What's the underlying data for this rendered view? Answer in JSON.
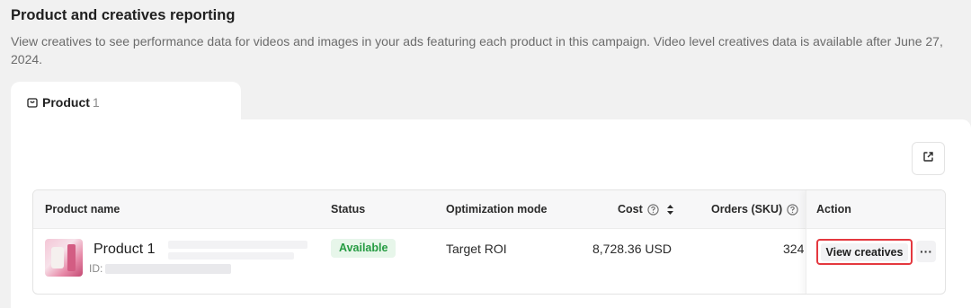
{
  "header": {
    "title": "Product and creatives reporting",
    "description": "View creatives to see performance data for videos and images in your ads featuring each product in this campaign. Video level creatives data is available after June 27, 2024."
  },
  "tabs": [
    {
      "label": "Product",
      "count": "1",
      "icon": "shopping-bag-icon"
    }
  ],
  "toolbar": {
    "export_icon": "external-link-icon"
  },
  "table": {
    "columns": {
      "product_name": "Product name",
      "status": "Status",
      "optimization_mode": "Optimization mode",
      "cost": "Cost",
      "orders": "Orders (SKU)",
      "action": "Action"
    },
    "rows": [
      {
        "name": "Product 1",
        "id_label": "ID:",
        "status": "Available",
        "optimization_mode": "Target ROI",
        "cost": "8,728.36 USD",
        "orders": "324",
        "action_label": "View creatives",
        "more_label": "···"
      }
    ]
  },
  "colors": {
    "status_available_bg": "#e7f6ea",
    "status_available_text": "#259b42",
    "highlight_border": "#e4383f"
  }
}
